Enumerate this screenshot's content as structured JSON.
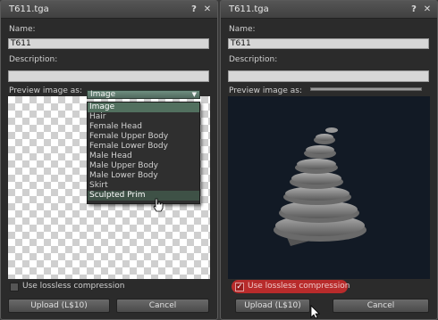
{
  "left": {
    "title": "T611.tga",
    "help_icon": "?",
    "close_icon": "✕",
    "name_label": "Name:",
    "name_value": "T611",
    "description_label": "Description:",
    "description_value": "",
    "preview_label": "Preview image as:",
    "preview_selected": "Image",
    "dropdown_options": [
      "Image",
      "Hair",
      "Female Head",
      "Female Upper Body",
      "Female Lower Body",
      "Male Head",
      "Male Upper Body",
      "Male Lower Body",
      "Skirt",
      "Sculpted Prim"
    ],
    "lossless_label": "Use lossless compression",
    "lossless_checked": false,
    "upload_label": "Upload (L$10)",
    "cancel_label": "Cancel"
  },
  "right": {
    "title": "T611.tga",
    "help_icon": "?",
    "close_icon": "✕",
    "name_label": "Name:",
    "name_value": "T611",
    "description_label": "Description:",
    "description_value": "",
    "preview_label": "Preview image as:",
    "lossless_label": "Use lossless compression",
    "lossless_checked": true,
    "upload_label": "Upload (L$10)",
    "cancel_label": "Cancel"
  },
  "colors": {
    "accent_green": "#52705f",
    "highlight_red": "#b82b2b",
    "preview_dark": "#121a25"
  }
}
